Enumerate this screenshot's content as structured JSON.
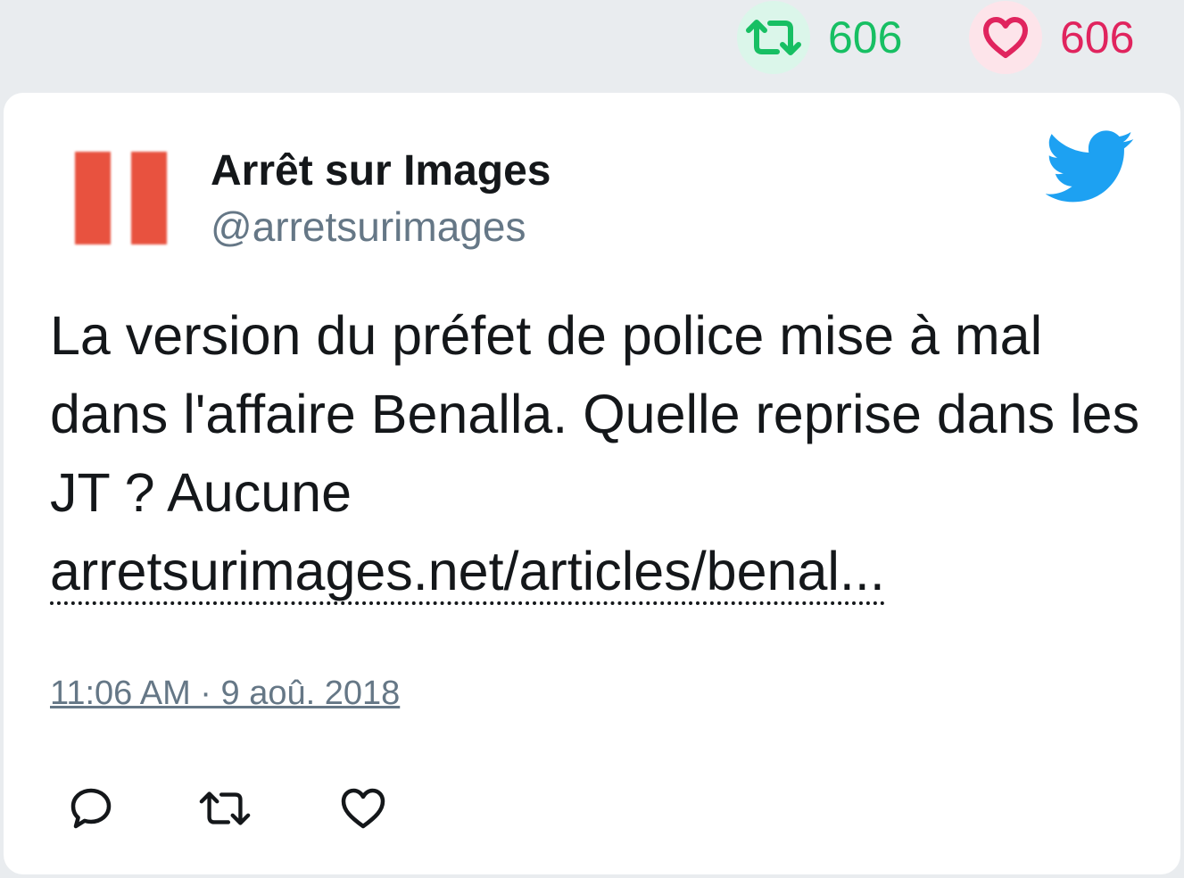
{
  "stats": {
    "retweet_count": "606",
    "like_count": "606",
    "retweet_color": "#17bf63",
    "like_color": "#e0245e"
  },
  "tweet": {
    "author_name": "Arrêt sur Images",
    "author_handle": "@arretsurimages",
    "text": "La version du préfet de police mise à mal dans l'affaire Benalla. Quelle reprise dans les JT ? Aucune",
    "link_text": "arretsurimages.net/articles/benal...",
    "timestamp": "11:06 AM · 9 aoû. 2018"
  },
  "icons": {
    "brand": "twitter-bird-icon",
    "actions": [
      "reply-icon",
      "retweet-icon",
      "like-icon"
    ]
  },
  "colors": {
    "brand_blue": "#1da1f2",
    "avatar_red": "#e8523f",
    "muted_text": "#657786",
    "page_bg": "#e9ecef"
  }
}
